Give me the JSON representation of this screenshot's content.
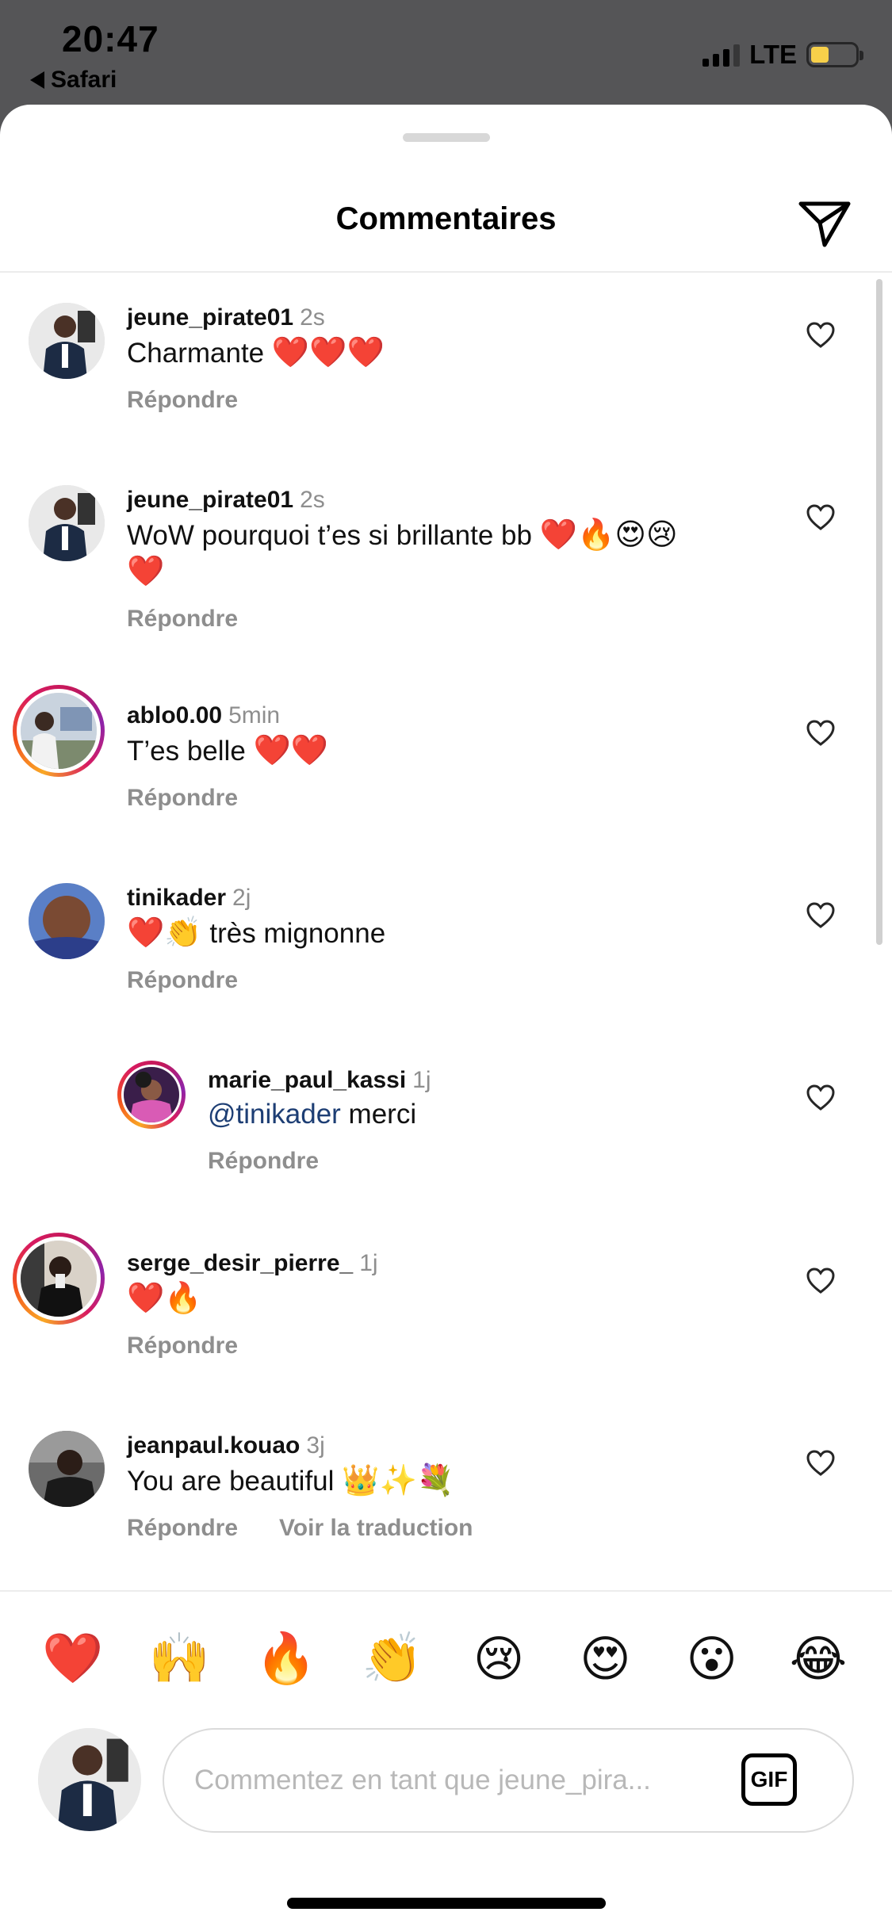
{
  "status_bar": {
    "time": "20:47",
    "back_app": "Safari",
    "network": "LTE",
    "battery_level": 0.3,
    "battery_color": "#f7d04a"
  },
  "sheet": {
    "title": "Commentaires",
    "share_icon": "paper-plane-icon"
  },
  "comments": [
    {
      "user": "jeune_pirate01",
      "time": "2s",
      "text": "Charmante ",
      "emoji": "❤️❤️❤️",
      "reply": "Répondre",
      "story": false,
      "avatar": "suit"
    },
    {
      "user": "jeune_pirate01",
      "time": "2s",
      "text": "WoW pourquoi t’es si brillante bb ",
      "emoji": "❤️🔥😍😢",
      "emoji_line2": "❤️",
      "reply": "Répondre",
      "story": false,
      "avatar": "suit"
    },
    {
      "user": "ablo0.00",
      "time": "5min",
      "text": "T’es belle ",
      "emoji": "❤️❤️",
      "reply": "Répondre",
      "story": true,
      "avatar": "outdoor"
    },
    {
      "user": "tinikader",
      "time": "2j",
      "emoji_prefix": "❤️👏",
      "text": " très mignonne",
      "reply": "Répondre",
      "story": false,
      "avatar": "selfie"
    },
    {
      "user": "marie_paul_kassi",
      "time": "1j",
      "mention": "@tinikader",
      "text": " merci",
      "reply": "Répondre",
      "story": true,
      "avatar": "portrait"
    },
    {
      "user": "serge_desir_pierre_",
      "time": "1j",
      "emoji": "❤️🔥",
      "reply": "Répondre",
      "story": true,
      "avatar": "mirror"
    },
    {
      "user": "jeanpaul.kouao",
      "time": "3j",
      "text": "You are beautiful ",
      "emoji": "👑✨💐",
      "reply": "Répondre",
      "translate": "Voir la traduction",
      "story": false,
      "avatar": "dark"
    }
  ],
  "emoji_bar": [
    "❤️",
    "🙌",
    "🔥",
    "👏",
    "😢",
    "😍",
    "😮",
    "😂"
  ],
  "composer": {
    "placeholder": "Commentez en tant que jeune_pira...",
    "gif_label": "GIF"
  },
  "colors": {
    "sheet_bg": "#ffffff",
    "secondary_text": "#8e8e8e",
    "mention": "#1d3e74",
    "status_bg": "#555557"
  }
}
